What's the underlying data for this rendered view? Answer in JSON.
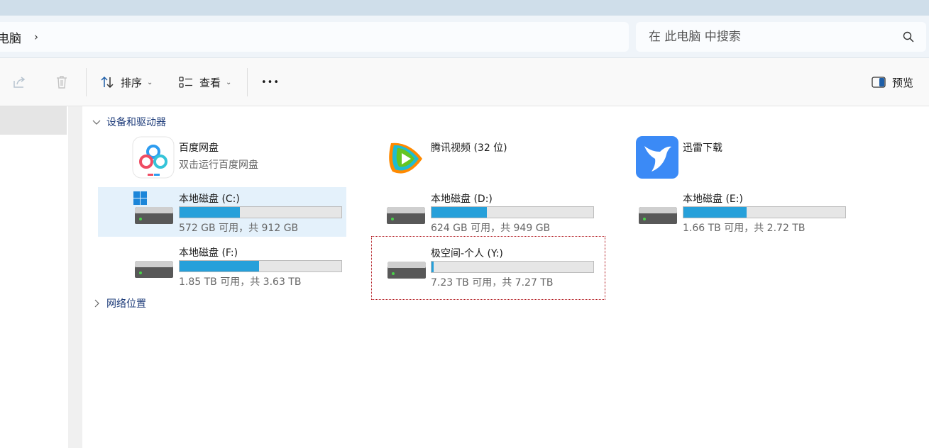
{
  "address": {
    "crumb": "电脑",
    "chevron": "›"
  },
  "search": {
    "placeholder": "在 此电脑 中搜索"
  },
  "toolbar": {
    "sort_label": "排序",
    "view_label": "查看",
    "more_label": "•••",
    "preview_label": "预览"
  },
  "groups": {
    "devices": "设备和驱动器",
    "network": "网络位置"
  },
  "apps": [
    {
      "name": "百度网盘",
      "subtitle": "双击运行百度网盘",
      "icon": "baidu-netdisk-icon"
    },
    {
      "name": "腾讯视频 (32 位)",
      "subtitle": "",
      "icon": "tencent-video-icon"
    },
    {
      "name": "迅雷下载",
      "subtitle": "",
      "icon": "thunder-download-icon"
    }
  ],
  "drives": [
    {
      "name": "本地磁盘 (C:)",
      "free": "572 GB 可用，共 912 GB",
      "used_fraction": 0.373,
      "icon": "system-drive-icon"
    },
    {
      "name": "本地磁盘 (D:)",
      "free": "624 GB 可用，共 949 GB",
      "used_fraction": 0.342,
      "icon": "drive-icon"
    },
    {
      "name": "本地磁盘 (E:)",
      "free": "1.66 TB 可用，共 2.72 TB",
      "used_fraction": 0.39,
      "icon": "drive-icon"
    },
    {
      "name": "本地磁盘 (F:)",
      "free": "1.85 TB 可用，共 3.63 TB",
      "used_fraction": 0.49,
      "icon": "drive-icon"
    },
    {
      "name": "极空间-个人 (Y:)",
      "free": "7.23 TB 可用，共 7.27 TB",
      "used_fraction": 0.012,
      "icon": "network-drive-icon"
    }
  ],
  "colors": {
    "bar_fill": "#26a0da",
    "selected_bg": "#e4f1fb",
    "group_header": "#1e3c7a"
  }
}
